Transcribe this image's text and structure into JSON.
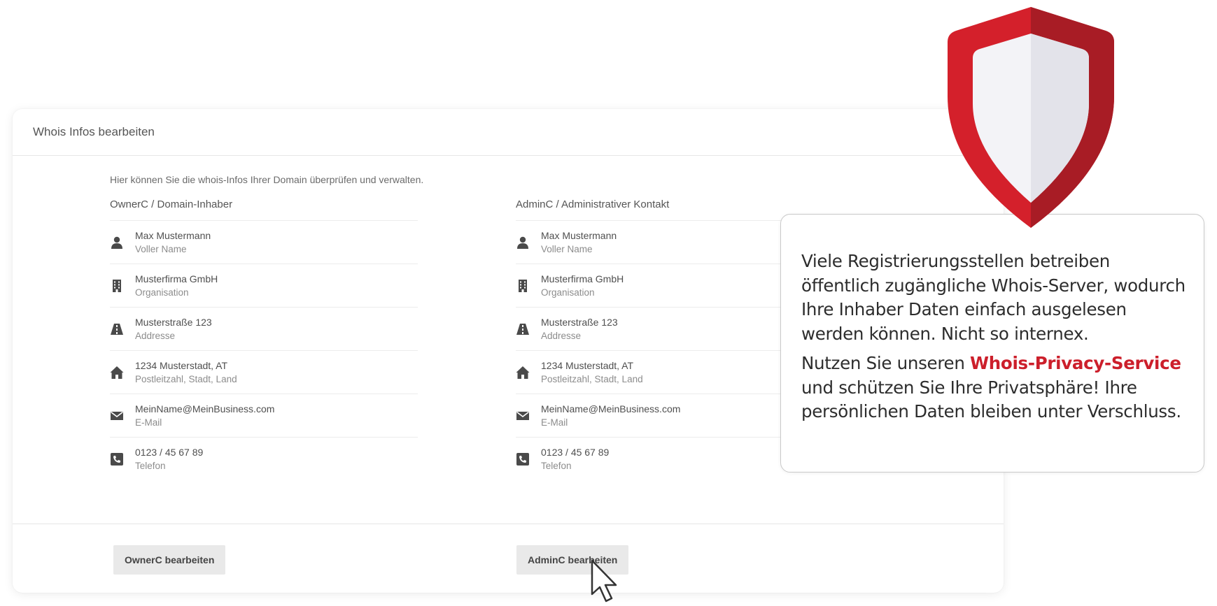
{
  "card": {
    "title": "Whois Infos bearbeiten",
    "intro": "Hier können Sie die whois-Infos Ihrer Domain überprüfen und verwalten."
  },
  "owner": {
    "title": "OwnerC / Domain-Inhaber",
    "rows": [
      {
        "icon": "user-icon",
        "value": "Max Mustermann",
        "label": "Voller Name"
      },
      {
        "icon": "building-icon",
        "value": "Musterfirma GmbH",
        "label": "Organisation"
      },
      {
        "icon": "road-icon",
        "value": "Musterstraße 123",
        "label": "Addresse"
      },
      {
        "icon": "home-icon",
        "value": "1234 Musterstadt, AT",
        "label": "Postleitzahl, Stadt, Land"
      },
      {
        "icon": "envelope-icon",
        "value": "MeinName@MeinBusiness.com",
        "label": "E-Mail"
      },
      {
        "icon": "phone-icon",
        "value": "0123 / 45 67 89",
        "label": "Telefon"
      }
    ],
    "button": "OwnerC bearbeiten"
  },
  "admin": {
    "title": "AdminC / Administrativer Kontakt",
    "rows": [
      {
        "icon": "user-icon",
        "value": "Max Mustermann",
        "label": "Voller Name"
      },
      {
        "icon": "building-icon",
        "value": "Musterfirma GmbH",
        "label": "Organisation"
      },
      {
        "icon": "road-icon",
        "value": "Musterstraße 123",
        "label": "Addresse"
      },
      {
        "icon": "home-icon",
        "value": "1234 Musterstadt, AT",
        "label": "Postleitzahl, Stadt, Land"
      },
      {
        "icon": "envelope-icon",
        "value": "MeinName@MeinBusiness.com",
        "label": "E-Mail"
      },
      {
        "icon": "phone-icon",
        "value": "0123 / 45 67 89",
        "label": "Telefon"
      }
    ],
    "button": "AdminC bearbeiten"
  },
  "callout": {
    "p1": "Viele Registrierungsstellen betreiben öffentlich zugängliche Whois-Server, wodurch Ihre Inhaber Daten einfach ausgelesen werden können. Nicht so internex.",
    "p2_pre": "Nutzen Sie unseren ",
    "p2_link": "Whois-Privacy-Service",
    "p2_post": " und schützen Sie Ihre Privatsphäre! Ihre persönlichen Daten bleiben unter Verschluss."
  },
  "colors": {
    "accent": "#cc1f2b",
    "shield_red": "#d4202b",
    "shield_red_dark": "#a81c25"
  },
  "icons": [
    "user-icon",
    "building-icon",
    "road-icon",
    "home-icon",
    "envelope-icon",
    "phone-icon",
    "shield-icon",
    "cursor-icon"
  ]
}
